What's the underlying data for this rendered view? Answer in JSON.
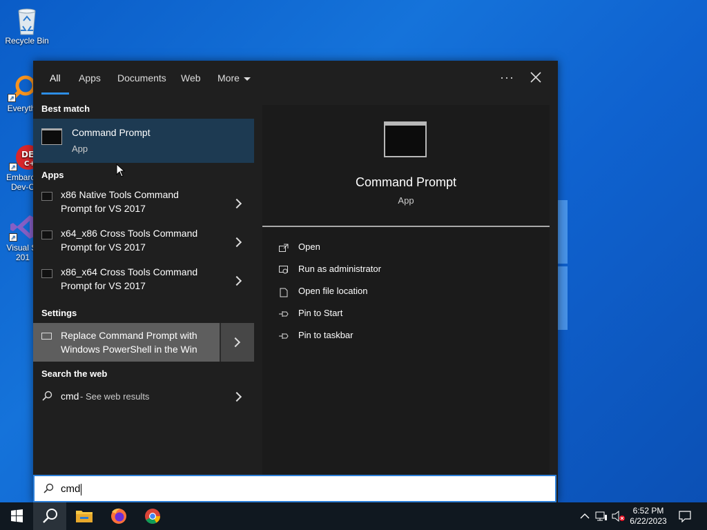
{
  "desktop": {
    "icons": [
      {
        "label": "Recycle Bin",
        "icon": "recycle-bin-icon"
      },
      {
        "label": "Everyth",
        "icon": "everything-search-icon"
      },
      {
        "label": "Embarca Dev-C",
        "icon": "devcpp-icon"
      },
      {
        "label": "Visual St 201",
        "icon": "visual-studio-icon"
      }
    ]
  },
  "search_panel": {
    "tabs": [
      {
        "label": "All",
        "active": true
      },
      {
        "label": "Apps"
      },
      {
        "label": "Documents"
      },
      {
        "label": "Web"
      },
      {
        "label": "More"
      }
    ],
    "more_options": "···",
    "sections": {
      "best_match": "Best match",
      "apps": "Apps",
      "settings": "Settings",
      "search_web": "Search the web"
    },
    "best_match": {
      "title": "Command Prompt",
      "subtitle": "App"
    },
    "apps": [
      {
        "line1": "x86 Native Tools Command",
        "line2": "Prompt for VS 2017"
      },
      {
        "line1": "x64_x86 Cross Tools Command",
        "line2": "Prompt for VS 2017"
      },
      {
        "line1": "x86_x64 Cross Tools Command",
        "line2": "Prompt for VS 2017"
      }
    ],
    "settings_item": {
      "line1": "Replace Command Prompt with",
      "line2": "Windows PowerShell in the Win"
    },
    "web_item": {
      "query": "cmd",
      "suffix": " - See web results"
    },
    "preview": {
      "title": "Command Prompt",
      "subtitle": "App",
      "actions": [
        {
          "label": "Open",
          "icon": "open-icon"
        },
        {
          "label": "Run as administrator",
          "icon": "run-as-admin-icon"
        },
        {
          "label": "Open file location",
          "icon": "file-location-icon"
        },
        {
          "label": "Pin to Start",
          "icon": "pin-icon"
        },
        {
          "label": "Pin to taskbar",
          "icon": "pin-icon"
        }
      ]
    },
    "search_value": "cmd"
  },
  "taskbar": {
    "time": "6:52 PM",
    "date": "6/22/2023"
  },
  "colors": {
    "accent": "#2d8ee5",
    "panel": "#1f1f1f",
    "selected": "#1d3a52"
  }
}
